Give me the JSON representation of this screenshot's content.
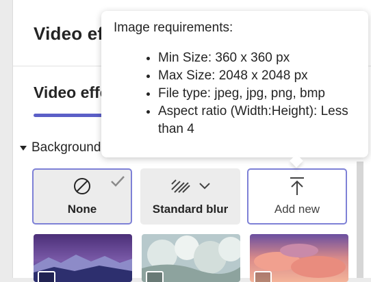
{
  "panel": {
    "title": "Video effects",
    "tab_label": "Video effects",
    "section_header": "Backgrounds"
  },
  "tiles": {
    "none_label": "None",
    "blur_label": "Standard blur",
    "add_label": "Add new"
  },
  "tooltip": {
    "heading": "Image requirements:",
    "items": [
      "Min Size: 360 x 360 px",
      "Max Size: 2048 x 2048 px",
      "File type: jpeg, jpg, png, bmp",
      "Aspect ratio (Width:Height): Less than 4"
    ]
  },
  "colors": {
    "accent": "#5b5fc7",
    "selected_border": "#7d80d6",
    "tile_bg": "#ececec"
  },
  "icons": [
    "prohibited-icon",
    "check-icon",
    "blur-icon",
    "chevron-down-icon",
    "upload-arrow-icon",
    "video-icon"
  ]
}
